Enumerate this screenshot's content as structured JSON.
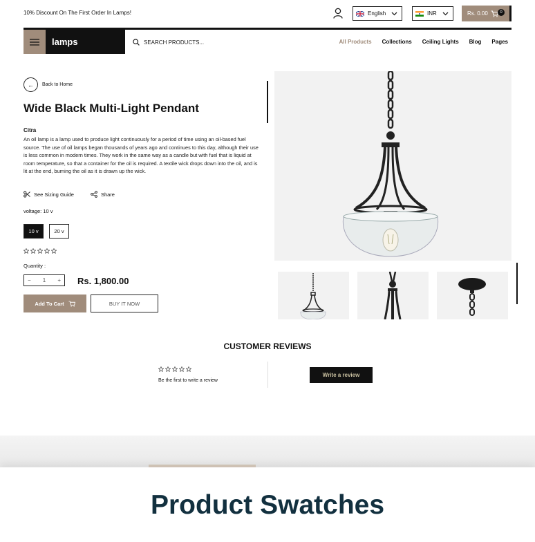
{
  "topbar": {
    "promo": "10% Discount On The First Order In Lamps!",
    "language": "English",
    "currency": "INR",
    "cart_total": "Rs. 0.00",
    "cart_count": "0"
  },
  "navbar": {
    "logo": "lamps",
    "search_placeholder": "SEARCH PRODUCTS...",
    "links": [
      "All Products",
      "Collections",
      "Ceiling Lights",
      "Blog",
      "Pages"
    ]
  },
  "product": {
    "back_label": "Back to Home",
    "title": "Wide Black Multi-Light Pendant",
    "brand": "Citra",
    "description": "An oil lamp is a lamp used to produce light continuously for a period of time using an oil-based fuel source. The use of oil lamps began thousands of years ago and continues to this day, although their use is less common in modern times. They work in the same way as a candle but with fuel that is liquid at room temperature, so that a container for the oil is required. A textile wick drops down into the oil, and is lit at the end, burning the oil as it is drawn up the wick.",
    "sizing_guide": "See Sizing Guide",
    "share": "Share",
    "voltage_label": "voltage: 10 v",
    "voltage_options": [
      "10 v",
      "20 v"
    ],
    "selected_voltage": "10 v",
    "quantity_label": "Quantity :",
    "quantity": "1",
    "price": "Rs. 1,800.00",
    "add_to_cart": "Add To Cart",
    "buy_now": "BUY IT NOW",
    "rating": 0
  },
  "reviews": {
    "title": "CUSTOMER REVIEWS",
    "empty_text": "Be the first to write a review",
    "write_button": "Write a review"
  },
  "footer_section": {
    "heading": "Product Swatches"
  },
  "colors": {
    "accent": "#a08c7b",
    "dark": "#111111",
    "heading": "#12303f"
  }
}
